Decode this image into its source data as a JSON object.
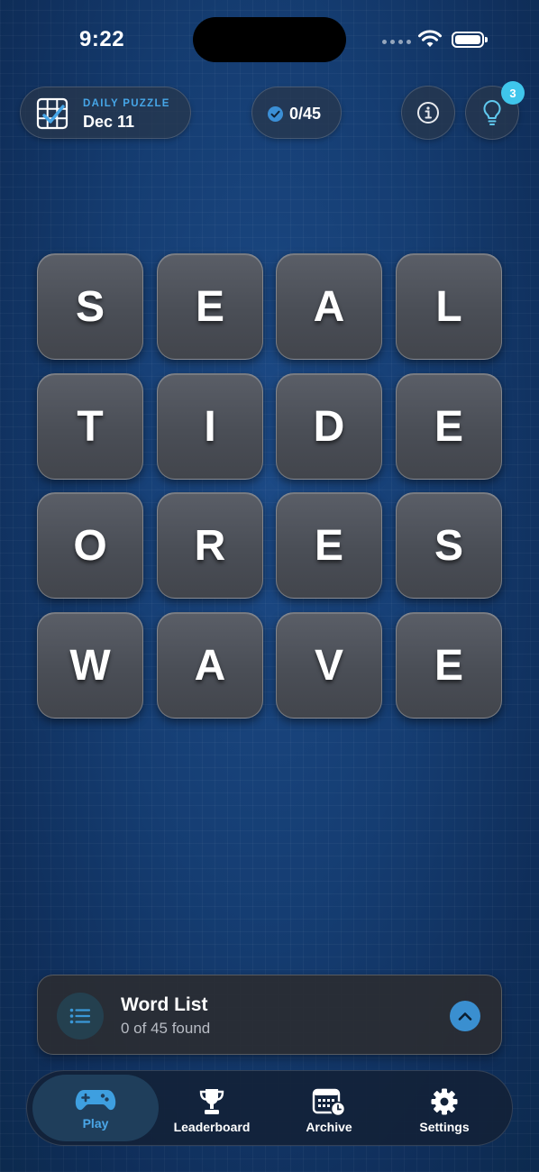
{
  "status": {
    "time": "9:22"
  },
  "header": {
    "daily_label": "DAILY PUZZLE",
    "date": "Dec 11",
    "progress": "0/45",
    "hint_count": "3"
  },
  "board": {
    "rows": [
      [
        "S",
        "E",
        "A",
        "L"
      ],
      [
        "T",
        "I",
        "D",
        "E"
      ],
      [
        "O",
        "R",
        "E",
        "S"
      ],
      [
        "W",
        "A",
        "V",
        "E"
      ]
    ]
  },
  "word_list": {
    "title": "Word List",
    "subtitle": "0 of 45 found"
  },
  "tabs": [
    {
      "label": "Play",
      "icon": "gamepad-icon",
      "active": true
    },
    {
      "label": "Leaderboard",
      "icon": "trophy-icon",
      "active": false
    },
    {
      "label": "Archive",
      "icon": "calendar-clock-icon",
      "active": false
    },
    {
      "label": "Settings",
      "icon": "gear-icon",
      "active": false
    }
  ],
  "colors": {
    "accent": "#46a6e8",
    "badge": "#3fc6ec",
    "background": "#153d72",
    "tile": "#4e5259"
  }
}
